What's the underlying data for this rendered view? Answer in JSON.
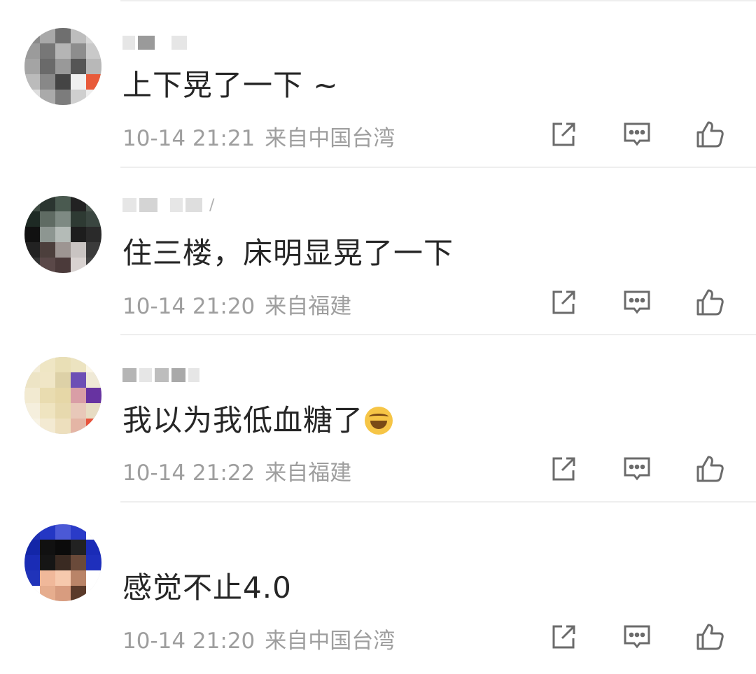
{
  "comments": [
    {
      "username": "",
      "content": "上下晃了一下 ~",
      "time": "10-14 21:21",
      "location": "来自中国台湾",
      "emoji": ""
    },
    {
      "username": "",
      "content": "住三楼，床明显晃了一下",
      "time": "10-14 21:20",
      "location": "来自福建",
      "emoji": ""
    },
    {
      "username": "",
      "content": "我以为我低血糖了",
      "time": "10-14 21:22",
      "location": "来自福建",
      "emoji": "tears-of-joy-emoji"
    },
    {
      "username": "",
      "content": "感觉不止4.0",
      "time": "10-14 21:20",
      "location": "来自中国台湾",
      "emoji": ""
    }
  ],
  "icons": {
    "share": "share-icon",
    "reply": "comment-icon",
    "like": "thumbs-up-icon"
  },
  "colors": {
    "text": "#262626",
    "meta": "#9e9e9e",
    "icon": "#6b6b6b",
    "divider": "#eeeeee"
  }
}
